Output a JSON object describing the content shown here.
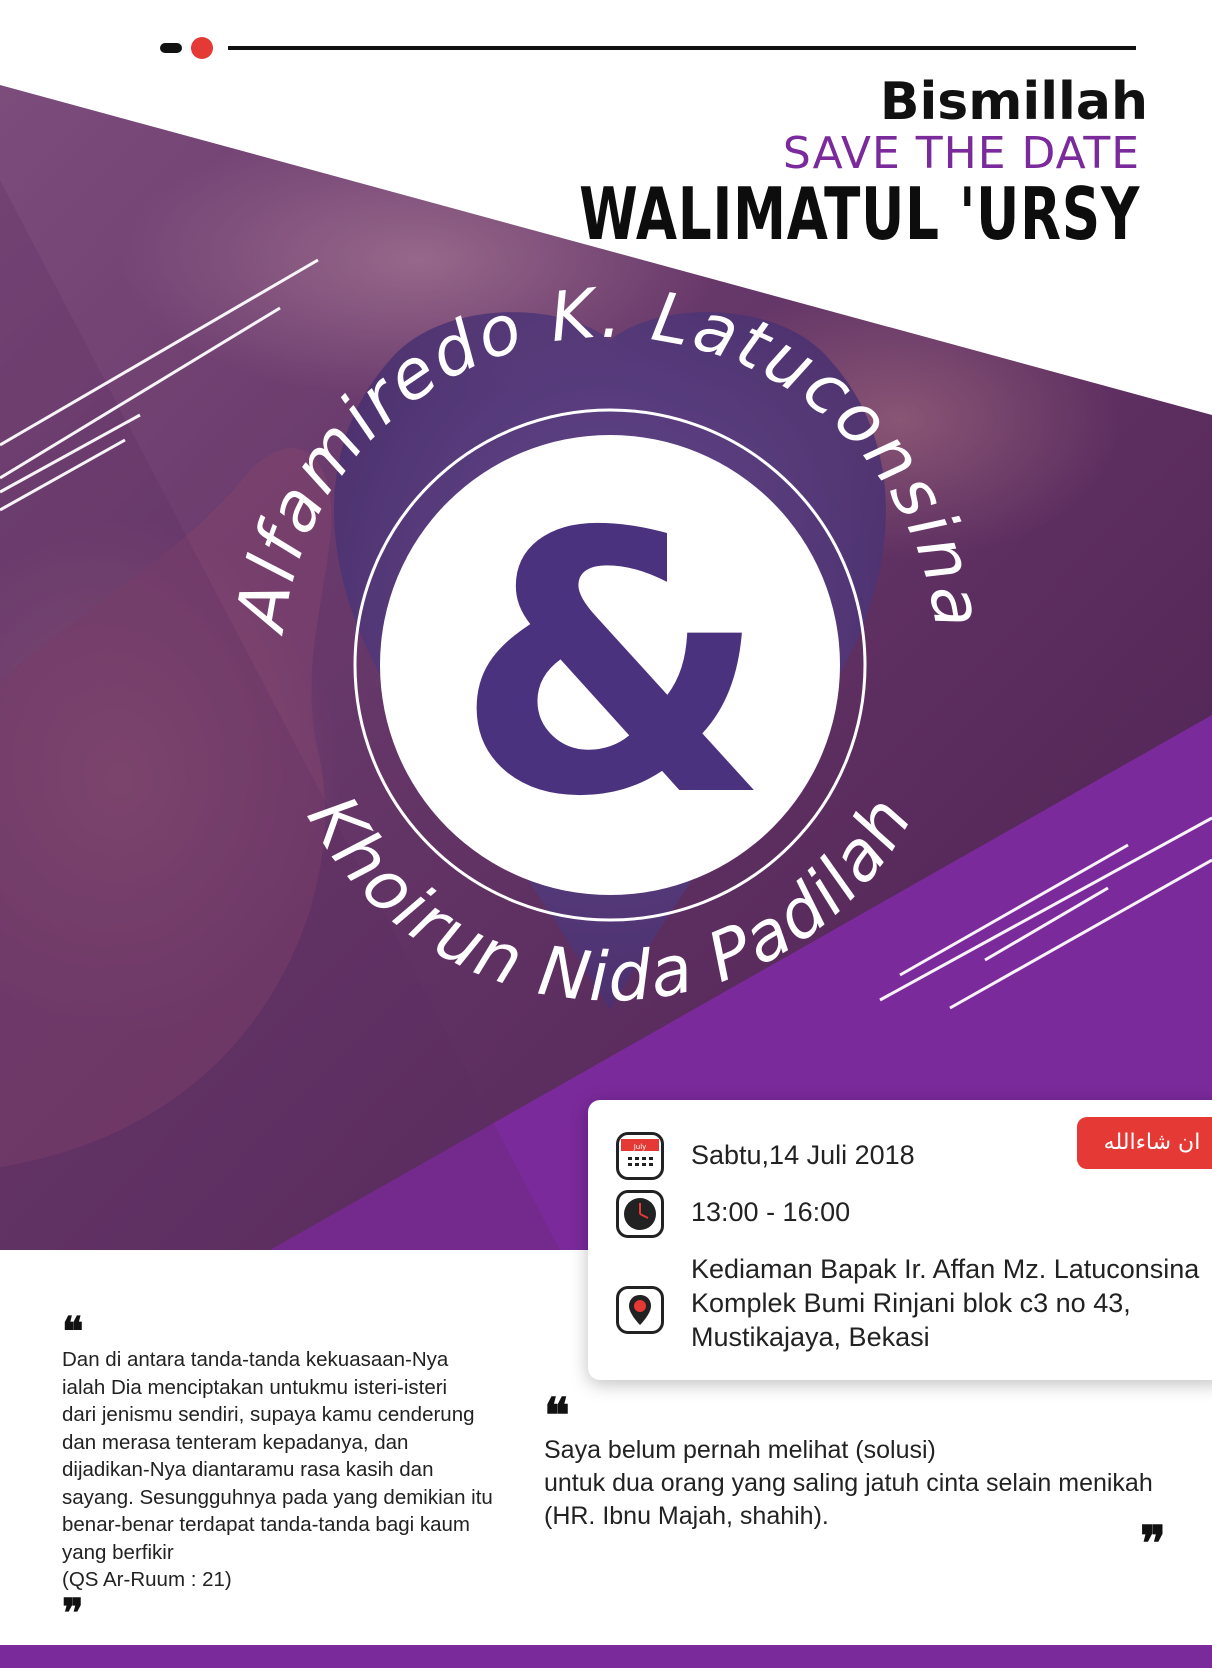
{
  "header": {
    "bismillah": "Bismillah",
    "save_the_date": "SAVE THE DATE",
    "event_title": "WALIMATUL 'URSY"
  },
  "couple": {
    "groom": "Alfamiredo K. Latuconsina",
    "bride": "Khoirun Nida Padilah",
    "ampersand": "&"
  },
  "event": {
    "insha_allah": "ان شاءالله",
    "date": "Sabtu,14 Juli 2018",
    "calendar_month": "July",
    "time": "13:00 - 16:00",
    "location_line1": "Kediaman Bapak Ir. Affan Mz. Latuconsina",
    "location_line2": "Komplek Bumi Rinjani blok c3 no 43,",
    "location_line3": "Mustikajaya, Bekasi"
  },
  "quotes": {
    "open_mark": "❝",
    "close_mark": "❞",
    "quran_lines": [
      "Dan di antara tanda-tanda kekuasaan-Nya",
      "ialah Dia menciptakan untukmu isteri-isteri",
      "dari jenismu sendiri, supaya kamu cenderung",
      "dan merasa tenteram kepadanya, dan",
      "dijadikan-Nya diantaramu rasa kasih dan",
      "sayang. Sesungguhnya pada yang demikian itu",
      "benar-benar terdapat tanda-tanda bagi kaum",
      "yang berfikir",
      "(QS Ar-Ruum : 21)"
    ],
    "hadith_lines": [
      "Saya belum pernah melihat (solusi)",
      "untuk dua orang yang saling jatuh cinta selain menikah",
      "(HR. Ibnu Majah, shahih)."
    ]
  },
  "colors": {
    "purple": "#7b2a9b",
    "red": "#e53935",
    "dark": "#111111"
  },
  "icons": {
    "calendar": "calendar-icon",
    "clock": "clock-icon",
    "location": "location-pin-icon"
  }
}
